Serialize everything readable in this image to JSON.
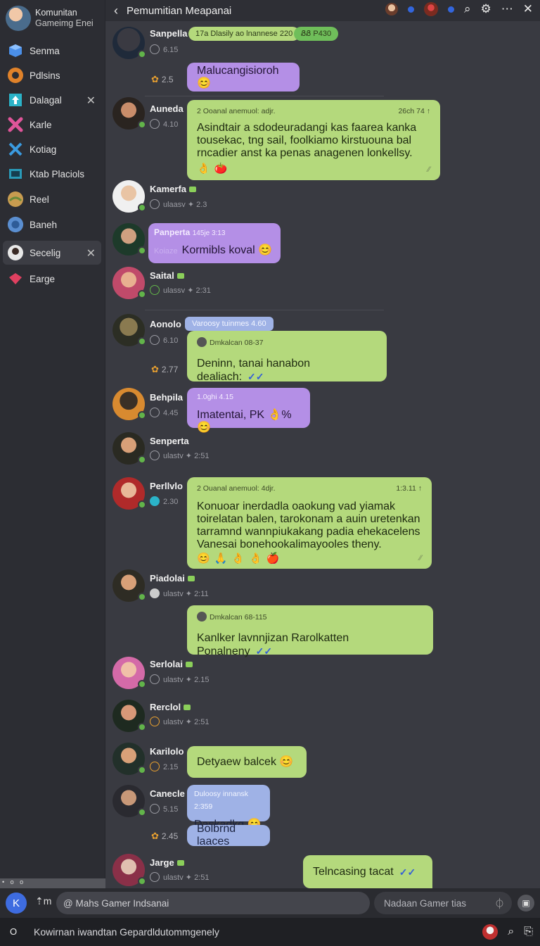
{
  "sidebar": {
    "title_line1": "Komunitan",
    "title_line2": "Gameimg Enei",
    "items": [
      {
        "label": "Senma",
        "icon": "cube-icon",
        "color": "#4b8fe8"
      },
      {
        "label": "Pdlsins",
        "icon": "gear-icon",
        "color": "#e0822a"
      },
      {
        "label": "Dalagal",
        "icon": "upload-icon",
        "color": "#2bb3c8",
        "close": "✕"
      },
      {
        "label": "Karle",
        "icon": "cross-icon",
        "color": "#e0559a"
      },
      {
        "label": "Kotiag",
        "icon": "x-icon",
        "color": "#3a9be0"
      },
      {
        "label": "Ktab Placiols",
        "icon": "monitor-icon",
        "color": "#2a9ab8"
      },
      {
        "label": "Reel",
        "icon": "map-icon",
        "color": "#c89c50"
      },
      {
        "label": "Baneh",
        "icon": "globe-icon",
        "color": "#5a8ed0"
      },
      {
        "label": "Secelig",
        "icon": "avatar-icon",
        "color": "#e8e8e8",
        "close": "✕"
      },
      {
        "label": "Earge",
        "icon": "diamond-icon",
        "color": "#e04060"
      }
    ],
    "dots": "• o o"
  },
  "topbar": {
    "back": "‹",
    "title": "Pemumitian Meapanai"
  },
  "messages": {
    "m1": {
      "name": "Sanpella",
      "meta": "6.15",
      "pill1": "17a Dlasily ao lnannese 220",
      "pill2": "ᏰᏰ P430",
      "react_count": "2.5",
      "text": "Malucangisioroh 😊"
    },
    "m2": {
      "name": "Auneda",
      "meta": "4.10",
      "head": "2 Ooanal anemuol: adjr.",
      "head_right": "26ch 74 ↑",
      "line1": "Asindtair a sdodeuradangi kas faarea kanka",
      "line2": "tousekac, tng sail, foolkiamo kirstuouna bal",
      "line3": "rncadier anst ka penas anagenen lonkellsy.",
      "emojis": "👌🍅",
      "check": "⁄⁄"
    },
    "m3": {
      "name": "Kamerfa",
      "meta": "ulaasv ✦ 2.3"
    },
    "m4": {
      "head": "Panperta",
      "head_time": "145je 3:13",
      "faint": "Koiaze",
      "text": "Kormibls koval 😊"
    },
    "m5": {
      "name": "Saital",
      "meta": "ulassv ✦ 2:31"
    },
    "m6": {
      "name": "Aonolo",
      "meta": "6.10",
      "pill": "Varoosy tuinmes 4.60",
      "head": "Dmkalcan 08-37",
      "text": "Deninn, tanai hanabon dealiach:",
      "ticks": "✓✓",
      "react_count": "2.77"
    },
    "m7": {
      "name": "Behpila",
      "meta": "4.45",
      "head": "1.0ghi 4.15",
      "text": "Imatentai, PK 👌%😊"
    },
    "m8": {
      "name": "Senperta",
      "meta": "ulastv ✦ 2:51"
    },
    "m9": {
      "name": "Perllvlo",
      "meta": "2.30",
      "head": "2 Ouanal anemuol: 4djr.",
      "head_right": "1:3.11 ↑",
      "line1": "Konuoar inerdadla oaokung  vad yiamak",
      "line2": "toirelatan balen, tarokonam a auin uretenkan",
      "line3": "tarramnd wannpiukakang padia ehekacelens",
      "line4": "Vanesai bonehookalimayooles theny.",
      "emojis": "😊🙏👌👌🍎",
      "check": "⁄⁄"
    },
    "m10": {
      "name": "Piadolai",
      "meta": "ulastv ✦ 2:11"
    },
    "m11": {
      "head": "Dmkalcan 68-115",
      "text": "Kanlker lavnnjizan Rarolkatten Ponalneny",
      "ticks": "✓✓"
    },
    "m12": {
      "name": "Serlolai",
      "meta": "ulastv ✦ 2.15"
    },
    "m13": {
      "name": "Rerclol",
      "meta": "ulastv ✦ 2:51"
    },
    "m14": {
      "name": "Karilolo",
      "meta": "2.15",
      "text": "Detyaew balcek 😊"
    },
    "m15": {
      "name": "Canecle",
      "meta": "5.15",
      "head": "Duloosy innansk 2:359",
      "text": "Daskadkg 😊",
      "react_count": "2.45"
    },
    "m16": {
      "text": "Bolbrnd laaces"
    },
    "m17": {
      "name": "Jarge",
      "meta": "ulastv ✦ 2:51",
      "text": "Telncasing tacat",
      "ticks": "✓✓"
    }
  },
  "composer": {
    "k_label": "K",
    "upload_label": "⇡m",
    "input1_value": "@ Mahs Gamer Indsanai",
    "input2_placeholder": "Nadaan Gamer tias"
  },
  "statusbar": {
    "o_label": "O",
    "text": "Kowirnan iwandtan Gepardldutommgenely"
  }
}
